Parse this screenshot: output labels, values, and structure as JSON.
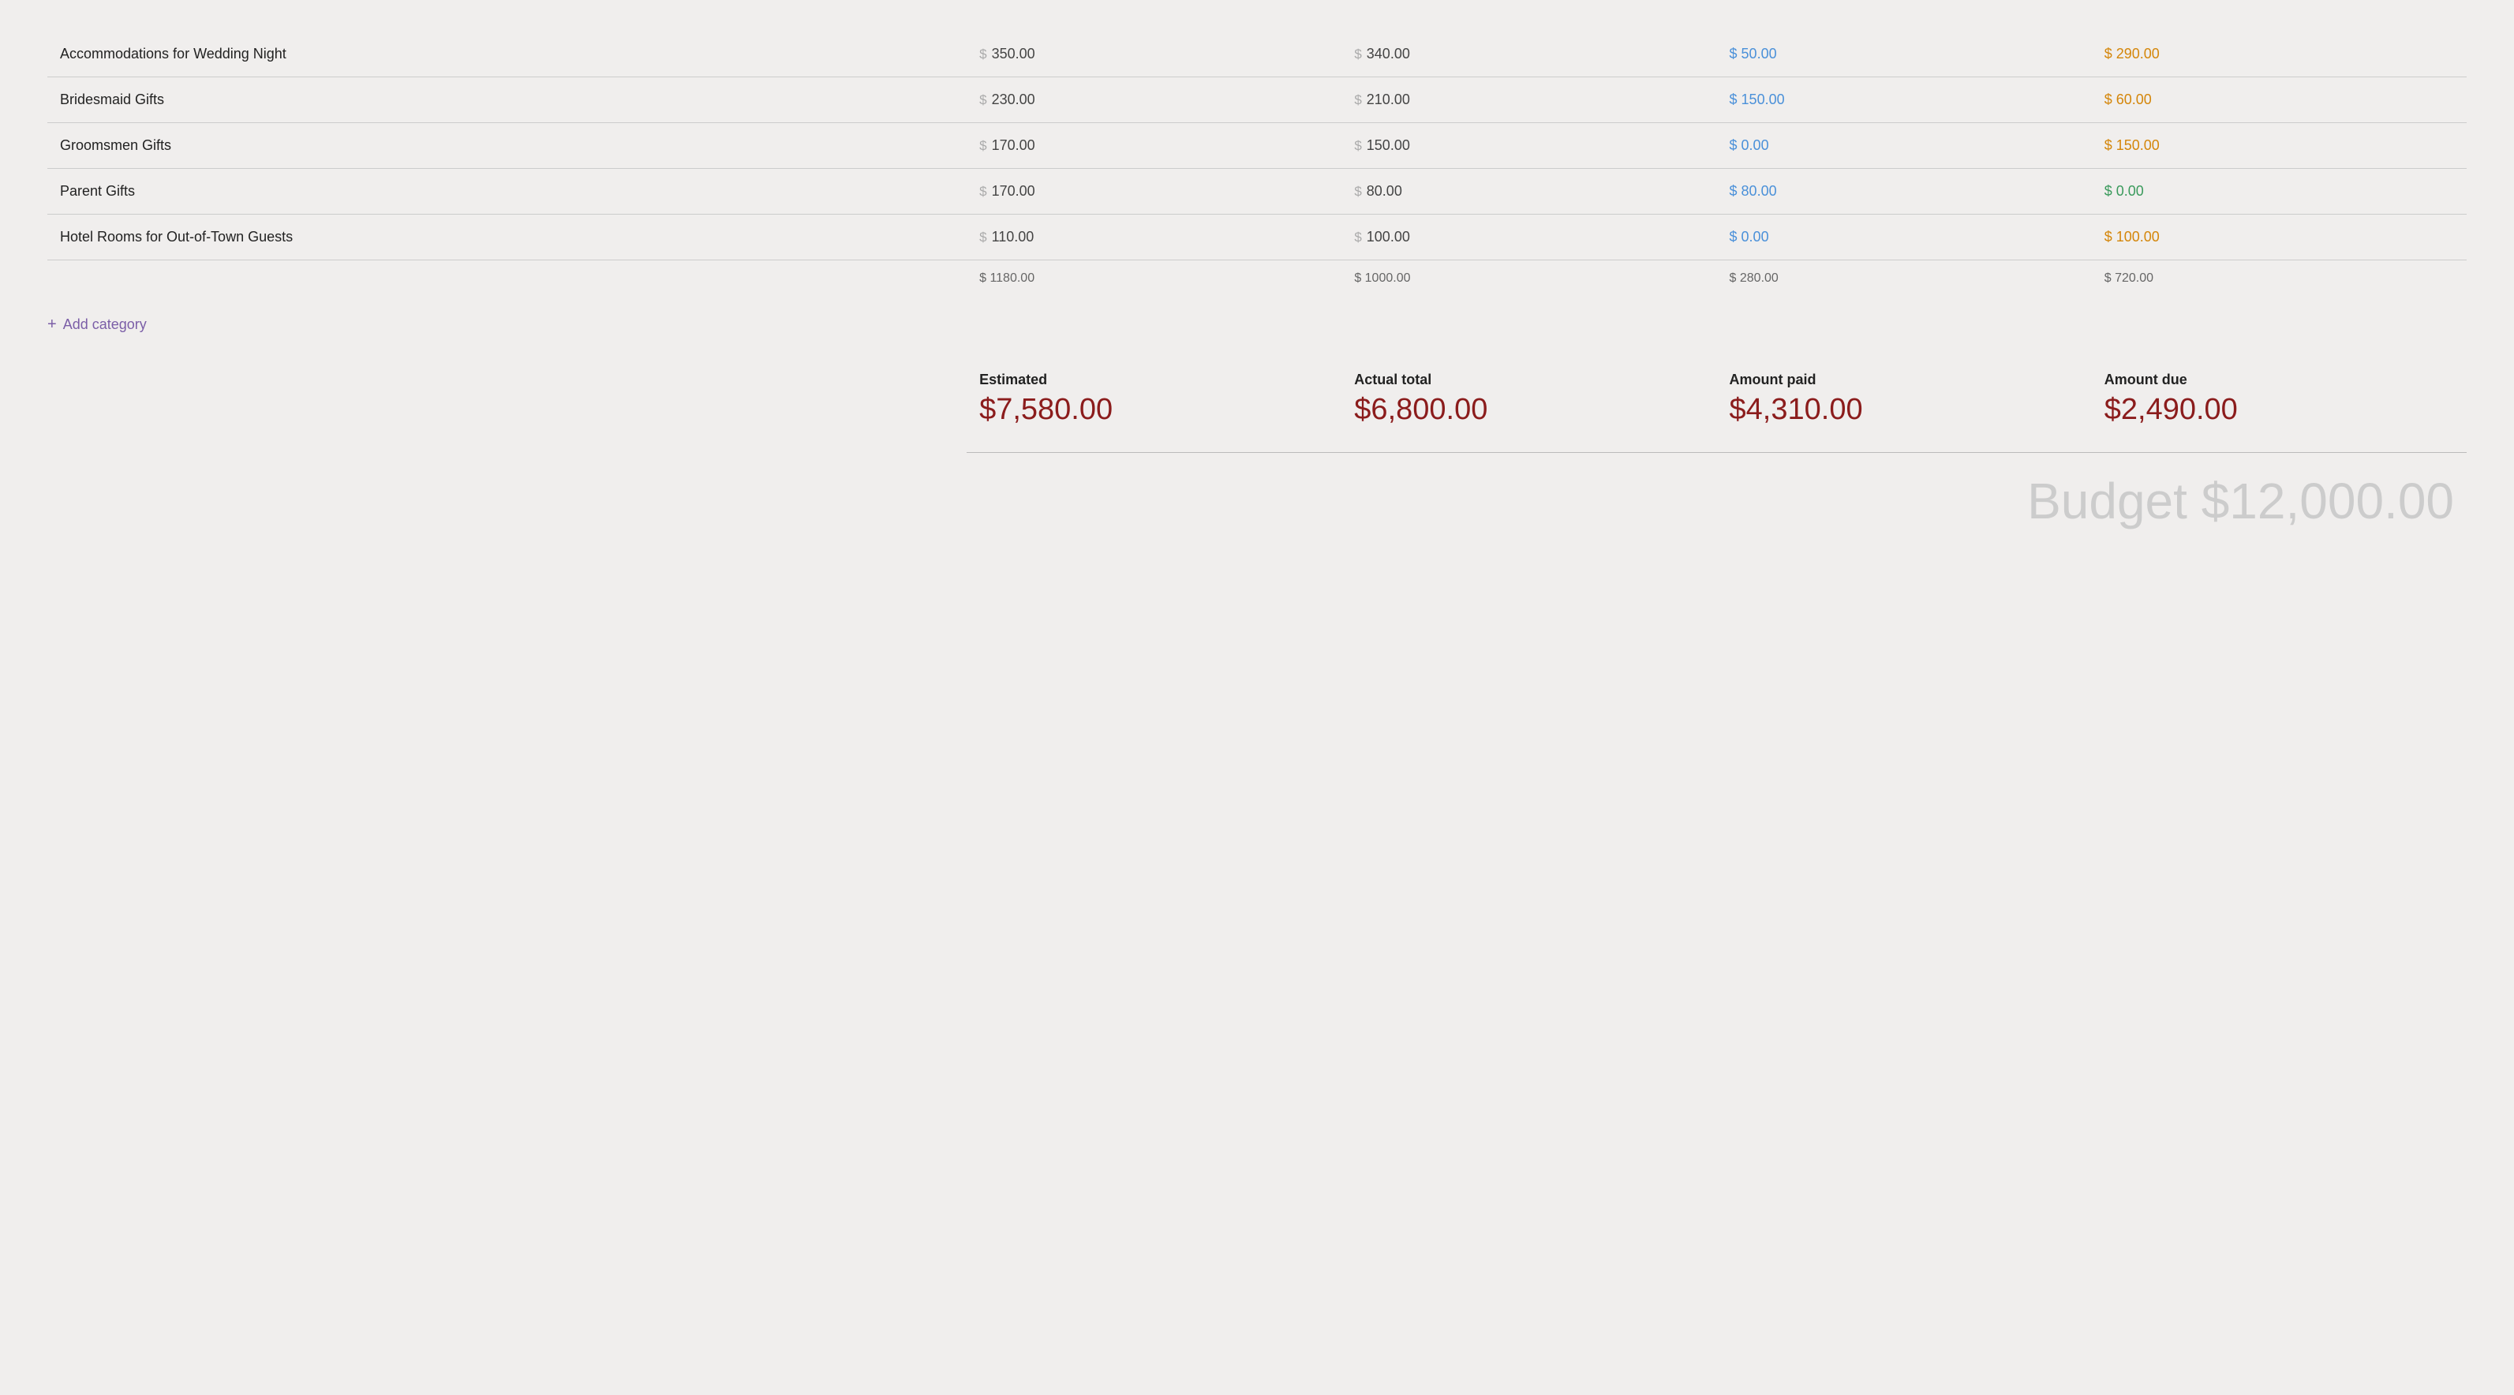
{
  "table": {
    "rows": [
      {
        "name": "Accommodations for Wedding Night",
        "estimated": "350.00",
        "actual": "340.00",
        "paid": "50.00",
        "due": "290.00",
        "paid_color": "blue",
        "due_color": "orange"
      },
      {
        "name": "Bridesmaid Gifts",
        "estimated": "230.00",
        "actual": "210.00",
        "paid": "150.00",
        "due": "60.00",
        "paid_color": "blue",
        "due_color": "orange"
      },
      {
        "name": "Groomsmen Gifts",
        "estimated": "170.00",
        "actual": "150.00",
        "paid": "0.00",
        "due": "150.00",
        "paid_color": "blue",
        "due_color": "orange"
      },
      {
        "name": "Parent Gifts",
        "estimated": "170.00",
        "actual": "80.00",
        "paid": "80.00",
        "due": "0.00",
        "paid_color": "blue",
        "due_color": "green"
      },
      {
        "name": "Hotel Rooms for Out-of-Town Guests",
        "estimated": "110.00",
        "actual": "100.00",
        "paid": "0.00",
        "due": "100.00",
        "paid_color": "blue",
        "due_color": "orange"
      }
    ],
    "subtotals": {
      "estimated": "$ 1180.00",
      "actual": "$ 1000.00",
      "paid": "$ 280.00",
      "due": "$ 720.00"
    }
  },
  "add_category_label": "Add category",
  "summary": {
    "estimated_label": "Estimated",
    "estimated_value": "$7,580.00",
    "actual_label": "Actual total",
    "actual_value": "$6,800.00",
    "paid_label": "Amount paid",
    "paid_value": "$4,310.00",
    "due_label": "Amount due",
    "due_value": "$2,490.00"
  },
  "budget_total_label": "Budget $12,000.00"
}
